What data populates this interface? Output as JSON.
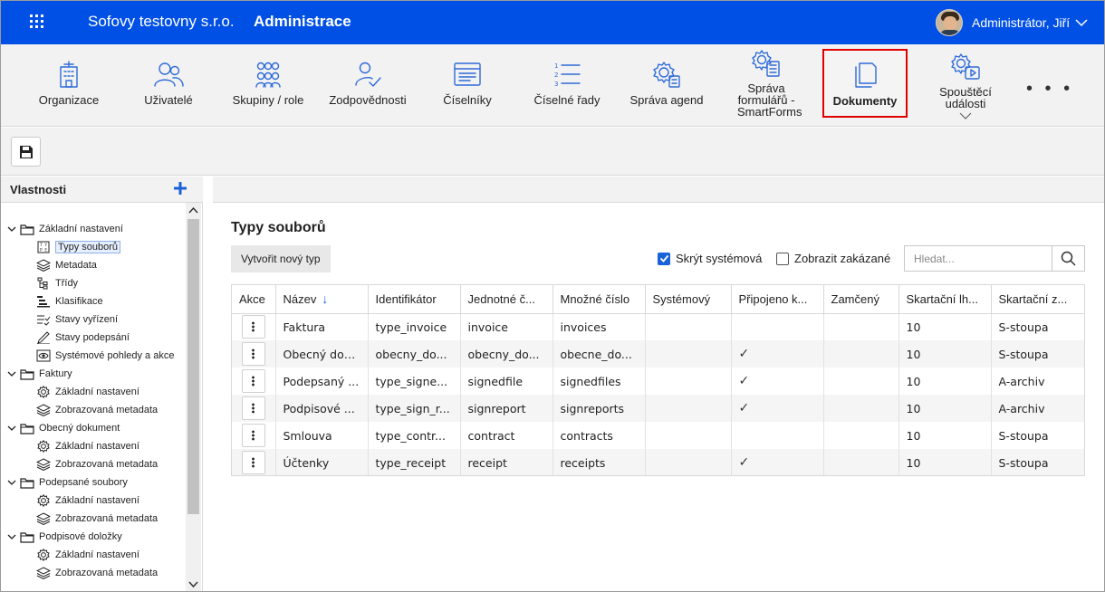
{
  "topbar": {
    "company": "Sofovy testovny s.r.o.",
    "section": "Administrace",
    "user_name": "Administrátor, Jiří"
  },
  "ribbon": {
    "items": [
      {
        "label": "Organizace",
        "icon": "organization-building-icon"
      },
      {
        "label": "Uživatelé",
        "icon": "users-icon"
      },
      {
        "label": "Skupiny / role",
        "icon": "groups-roles-icon"
      },
      {
        "label": "Zodpovědnosti",
        "icon": "responsibility-user-check-icon"
      },
      {
        "label": "Číselníky",
        "icon": "codelist-window-icon"
      },
      {
        "label": "Číselné řady",
        "icon": "numbered-list-icon"
      },
      {
        "label": "Správa agend",
        "icon": "agenda-gear-icon"
      },
      {
        "label": "Správa formulářů - SmartForms",
        "icon": "forms-gear-icon"
      },
      {
        "label": "Dokumenty",
        "icon": "documents-icon",
        "active": true
      },
      {
        "label": "Spouštěcí události",
        "icon": "trigger-events-icon"
      }
    ],
    "more_label": "• • •",
    "accent_color": "#2f6bd8",
    "active_outline_color": "#e00000"
  },
  "toolbar": {
    "save_icon": "floppy-disk-icon"
  },
  "properties": {
    "title": "Vlastnosti",
    "tree": [
      {
        "label": "Základní nastavení",
        "level": 0,
        "type": "folder"
      },
      {
        "label": "Typy souborů",
        "level": 1,
        "type": "file-types",
        "selected": true
      },
      {
        "label": "Metadata",
        "level": 1,
        "type": "layers"
      },
      {
        "label": "Třídy",
        "level": 1,
        "type": "classes"
      },
      {
        "label": "Klasifikace",
        "level": 1,
        "type": "classification"
      },
      {
        "label": "Stavy vyřízení",
        "level": 1,
        "type": "checklist"
      },
      {
        "label": "Stavy podepsání",
        "level": 1,
        "type": "pen"
      },
      {
        "label": "Systémové pohledy a akce",
        "level": 1,
        "type": "eye"
      },
      {
        "label": "Faktury",
        "level": 0,
        "type": "folder"
      },
      {
        "label": "Základní nastavení",
        "level": 1,
        "type": "gear"
      },
      {
        "label": "Zobrazovaná metadata",
        "level": 1,
        "type": "layers"
      },
      {
        "label": "Obecný dokument",
        "level": 0,
        "type": "folder"
      },
      {
        "label": "Základní nastavení",
        "level": 1,
        "type": "gear"
      },
      {
        "label": "Zobrazovaná metadata",
        "level": 1,
        "type": "layers"
      },
      {
        "label": "Podepsané soubory",
        "level": 0,
        "type": "folder"
      },
      {
        "label": "Základní nastavení",
        "level": 1,
        "type": "gear"
      },
      {
        "label": "Zobrazovaná metadata",
        "level": 1,
        "type": "layers"
      },
      {
        "label": "Podpisové doložky",
        "level": 0,
        "type": "folder"
      },
      {
        "label": "Základní nastavení",
        "level": 1,
        "type": "gear"
      },
      {
        "label": "Zobrazovaná metadata",
        "level": 1,
        "type": "layers"
      }
    ]
  },
  "main": {
    "title": "Typy souborů",
    "create_button": "Vytvořit nový typ",
    "hide_system_label": "Skrýt systémová",
    "hide_system_checked": true,
    "show_disabled_label": "Zobrazit zakázané",
    "show_disabled_checked": false,
    "search_placeholder": "Hledat...",
    "table": {
      "columns": [
        "Akce",
        "Název",
        "Identifikátor",
        "Jednotné č...",
        "Množné číslo",
        "Systémový",
        "Připojeno k...",
        "Zamčený",
        "Skartační lh...",
        "Skartační z..."
      ],
      "sorted_column": "Název",
      "sort_direction": "ascending",
      "rows": [
        {
          "nazev": "Faktura",
          "id": "type_invoice",
          "singular": "invoice",
          "plural": "invoices",
          "system": "",
          "attached": "",
          "locked": "",
          "period": "10",
          "mode": "S-stoupa"
        },
        {
          "nazev": "Obecný dok...",
          "id": "obecny_do...",
          "singular": "obecny_do...",
          "plural": "obecne_do...",
          "system": "",
          "attached": "✓",
          "locked": "",
          "period": "10",
          "mode": "S-stoupa"
        },
        {
          "nazev": "Podepsaný ...",
          "id": "type_signe...",
          "singular": "signedfile",
          "plural": "signedfiles",
          "system": "",
          "attached": "✓",
          "locked": "",
          "period": "10",
          "mode": "A-archiv"
        },
        {
          "nazev": "Podpisové ...",
          "id": "type_sign_r...",
          "singular": "signreport",
          "plural": "signreports",
          "system": "",
          "attached": "✓",
          "locked": "",
          "period": "10",
          "mode": "A-archiv"
        },
        {
          "nazev": "Smlouva",
          "id": "type_contr...",
          "singular": "contract",
          "plural": "contracts",
          "system": "",
          "attached": "",
          "locked": "",
          "period": "10",
          "mode": "S-stoupa"
        },
        {
          "nazev": "Účtenky",
          "id": "type_receipt",
          "singular": "receipt",
          "plural": "receipts",
          "system": "",
          "attached": "✓",
          "locked": "",
          "period": "10",
          "mode": "S-stoupa"
        }
      ]
    }
  }
}
